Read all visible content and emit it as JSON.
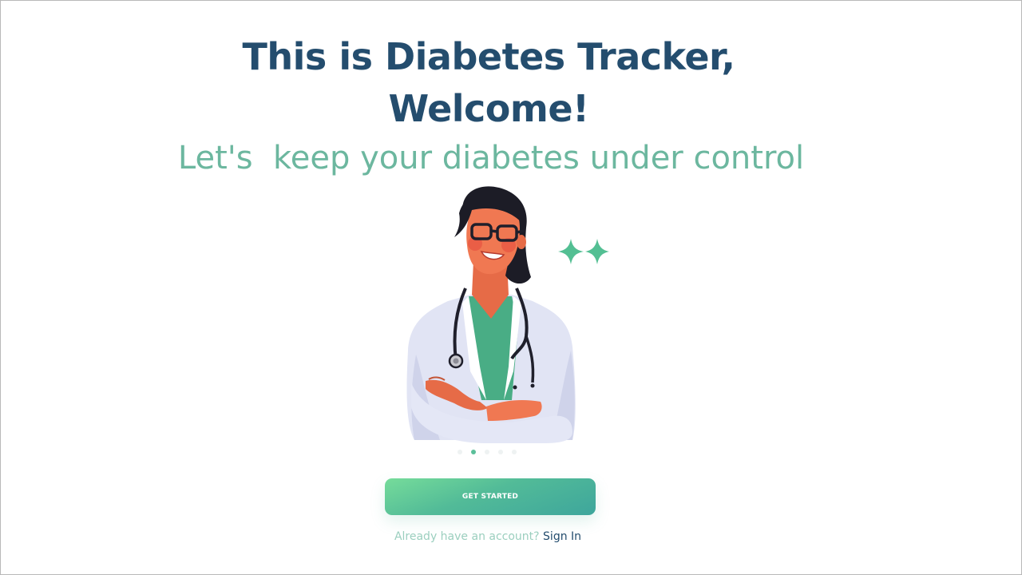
{
  "hero": {
    "title_line1": "This is Diabetes Tracker,",
    "title_line2": "Welcome!",
    "subtitle": "Let's  keep your diabetes under control"
  },
  "carousel": {
    "slide_count": 5,
    "active_index": 1
  },
  "cta": {
    "label": "GET STARTED"
  },
  "signin": {
    "prompt": "Already have an account?",
    "link": "Sign In"
  },
  "colors": {
    "title": "#244d6e",
    "subtitle": "#6cb79f",
    "accent_green": "#5bbf9a",
    "button_start": "#76dc9a",
    "button_end": "#3ea69c"
  },
  "icons": [
    "doctor-illustration",
    "sparkle-icon",
    "sparkle-icon"
  ]
}
